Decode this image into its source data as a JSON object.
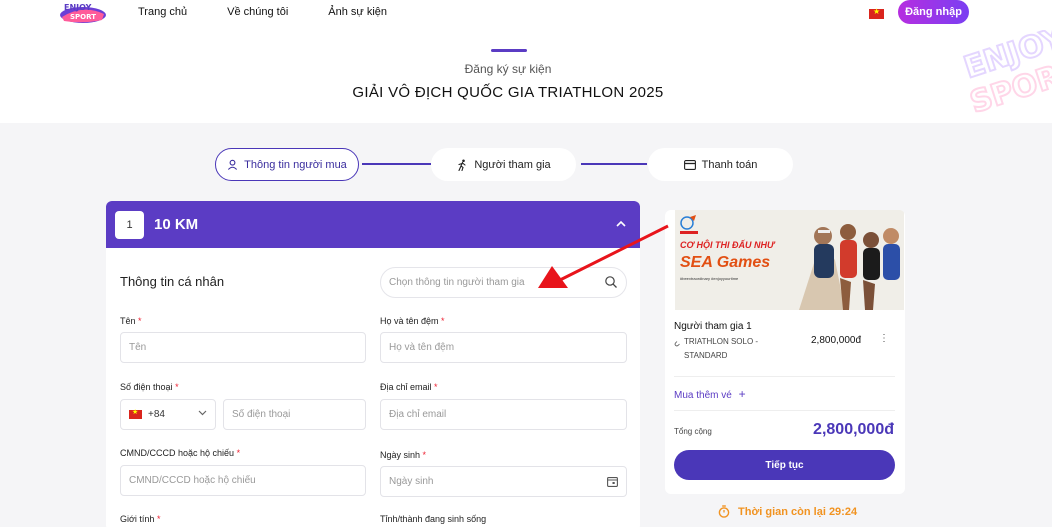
{
  "header": {
    "logo_text": "Enjoy Sport",
    "nav": [
      "Trang chủ",
      "Về chúng tôi",
      "Ảnh sự kiện"
    ],
    "login_label": "Đăng nhập"
  },
  "event": {
    "subtitle": "Đăng ký sự kiện",
    "title": "GIẢI VÔ ĐỊCH QUỐC GIA TRIATHLON 2025"
  },
  "steps": [
    {
      "label": "Thông tin người mua",
      "icon": "user-icon",
      "active": true
    },
    {
      "label": "Người tham gia",
      "icon": "runner-icon",
      "active": false
    },
    {
      "label": "Thanh toán",
      "icon": "credit-card-icon",
      "active": false
    }
  ],
  "card": {
    "number": "1",
    "distance": "10 KM",
    "section_title": "Thông tin cá nhân",
    "search_placeholder": "Chọn thông tin người tham gia",
    "fields": {
      "first_name": {
        "label": "Tên",
        "placeholder": "Tên"
      },
      "last_name": {
        "label": "Họ và tên đệm",
        "placeholder": "Họ và tên đệm"
      },
      "phone": {
        "label": "Số điện thoại",
        "placeholder": "Số điện thoại",
        "country_code": "+84"
      },
      "email": {
        "label": "Địa chỉ email",
        "placeholder": "Địa chỉ email"
      },
      "id": {
        "label": "CMND/CCCD hoặc hộ chiếu",
        "placeholder": "CMND/CCCD hoặc hộ chiếu"
      },
      "dob": {
        "label": "Ngày sinh",
        "placeholder": "Ngày sinh"
      },
      "gender": {
        "label": "Giới tính"
      },
      "province": {
        "label": "Tỉnh/thành đang sinh sống"
      }
    },
    "required_mark": "*"
  },
  "summary": {
    "banner_line1": "CƠ HỘI THI ĐẤU NHƯ",
    "banner_line2": "SEA Games",
    "banner_line3": "#beextraordinary #enjoyyourtime",
    "participant": "Người tham gia 1",
    "ticket": "TRIATHLON SOLO - STANDARD",
    "price": "2,800,000đ",
    "more_icon": "⋮",
    "buy_more": "Mua thêm vé",
    "total_label": "Tổng cộng",
    "total_value": "2,800,000đ",
    "continue_label": "Tiếp tục"
  },
  "timer": {
    "text": "Thời gian còn lại 29:24"
  },
  "colors": {
    "primary": "#5b3cc4",
    "accent": "#4a37b8",
    "timer": "#f19321",
    "arrow": "#e8141b"
  }
}
